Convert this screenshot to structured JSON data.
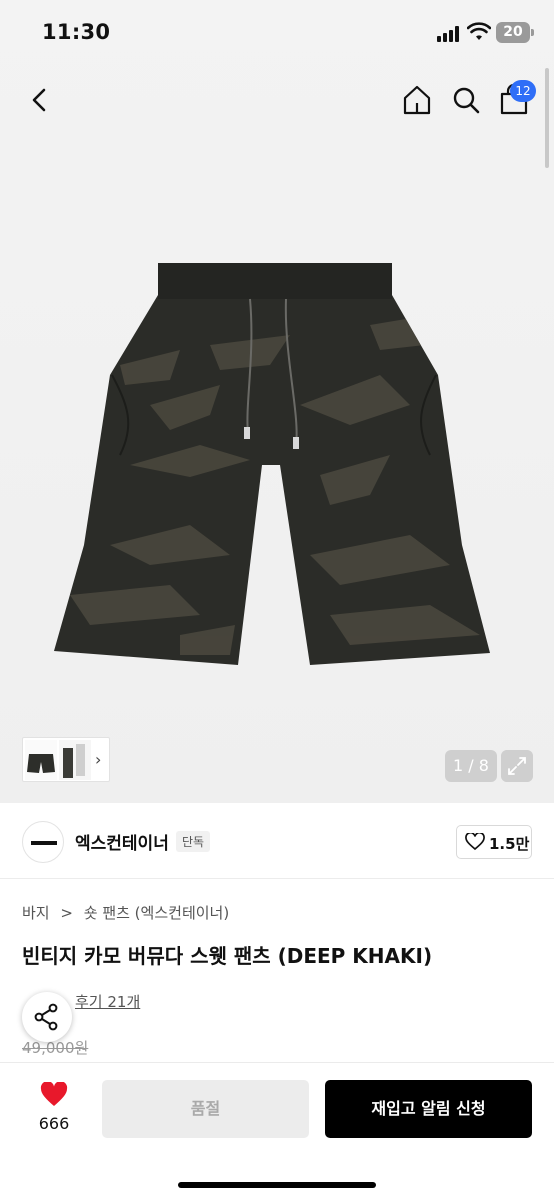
{
  "status_bar": {
    "time": "11:30",
    "battery": "20"
  },
  "nav": {
    "cart_count": "12",
    "icons": [
      "back-arrow-icon",
      "home-icon",
      "search-icon",
      "shopping-bag-icon"
    ]
  },
  "gallery": {
    "pager": "1 / 8",
    "expand_icon": "expand-icon"
  },
  "brand": {
    "logo_text": "EXCONTAINER",
    "name": "엑스컨테이너",
    "tag": "단독",
    "likes": "1.5만"
  },
  "breadcrumb": {
    "category": "바지",
    "separator": ">",
    "subcategory": "숏 팬츠 (엑스컨테이너)"
  },
  "product": {
    "title": "빈티지 카모 버뮤다 스웻 팬츠 (DEEP KHAKI)",
    "reviews": "후기 21개",
    "original_price": "49,000원"
  },
  "bottom_bar": {
    "wish_count": "666",
    "soldout_label": "품절",
    "restock_label": "재입고 알림 신청"
  },
  "colors": {
    "accent_blue": "#2f6ef7",
    "heart_red": "#e8182b",
    "cta_black": "#000000"
  }
}
